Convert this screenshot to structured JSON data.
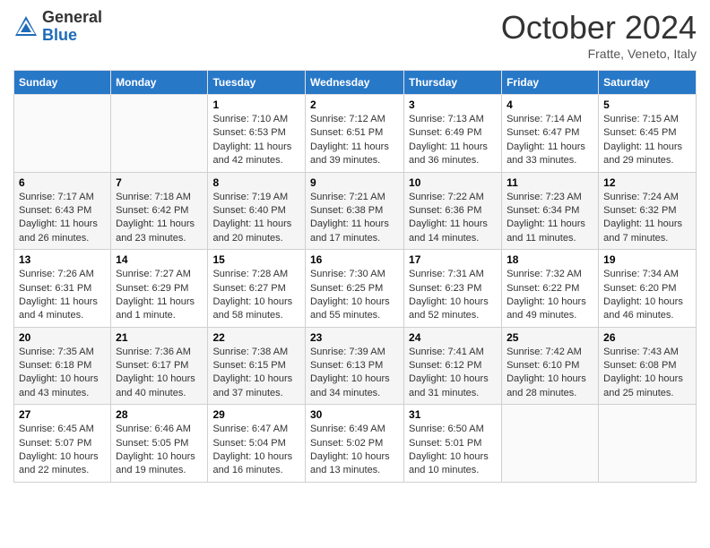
{
  "logo": {
    "general": "General",
    "blue": "Blue"
  },
  "header": {
    "title": "October 2024",
    "subtitle": "Fratte, Veneto, Italy"
  },
  "days_of_week": [
    "Sunday",
    "Monday",
    "Tuesday",
    "Wednesday",
    "Thursday",
    "Friday",
    "Saturday"
  ],
  "weeks": [
    [
      {
        "day": "",
        "content": ""
      },
      {
        "day": "",
        "content": ""
      },
      {
        "day": "1",
        "content": "Sunrise: 7:10 AM\nSunset: 6:53 PM\nDaylight: 11 hours and 42 minutes."
      },
      {
        "day": "2",
        "content": "Sunrise: 7:12 AM\nSunset: 6:51 PM\nDaylight: 11 hours and 39 minutes."
      },
      {
        "day": "3",
        "content": "Sunrise: 7:13 AM\nSunset: 6:49 PM\nDaylight: 11 hours and 36 minutes."
      },
      {
        "day": "4",
        "content": "Sunrise: 7:14 AM\nSunset: 6:47 PM\nDaylight: 11 hours and 33 minutes."
      },
      {
        "day": "5",
        "content": "Sunrise: 7:15 AM\nSunset: 6:45 PM\nDaylight: 11 hours and 29 minutes."
      }
    ],
    [
      {
        "day": "6",
        "content": "Sunrise: 7:17 AM\nSunset: 6:43 PM\nDaylight: 11 hours and 26 minutes."
      },
      {
        "day": "7",
        "content": "Sunrise: 7:18 AM\nSunset: 6:42 PM\nDaylight: 11 hours and 23 minutes."
      },
      {
        "day": "8",
        "content": "Sunrise: 7:19 AM\nSunset: 6:40 PM\nDaylight: 11 hours and 20 minutes."
      },
      {
        "day": "9",
        "content": "Sunrise: 7:21 AM\nSunset: 6:38 PM\nDaylight: 11 hours and 17 minutes."
      },
      {
        "day": "10",
        "content": "Sunrise: 7:22 AM\nSunset: 6:36 PM\nDaylight: 11 hours and 14 minutes."
      },
      {
        "day": "11",
        "content": "Sunrise: 7:23 AM\nSunset: 6:34 PM\nDaylight: 11 hours and 11 minutes."
      },
      {
        "day": "12",
        "content": "Sunrise: 7:24 AM\nSunset: 6:32 PM\nDaylight: 11 hours and 7 minutes."
      }
    ],
    [
      {
        "day": "13",
        "content": "Sunrise: 7:26 AM\nSunset: 6:31 PM\nDaylight: 11 hours and 4 minutes."
      },
      {
        "day": "14",
        "content": "Sunrise: 7:27 AM\nSunset: 6:29 PM\nDaylight: 11 hours and 1 minute."
      },
      {
        "day": "15",
        "content": "Sunrise: 7:28 AM\nSunset: 6:27 PM\nDaylight: 10 hours and 58 minutes."
      },
      {
        "day": "16",
        "content": "Sunrise: 7:30 AM\nSunset: 6:25 PM\nDaylight: 10 hours and 55 minutes."
      },
      {
        "day": "17",
        "content": "Sunrise: 7:31 AM\nSunset: 6:23 PM\nDaylight: 10 hours and 52 minutes."
      },
      {
        "day": "18",
        "content": "Sunrise: 7:32 AM\nSunset: 6:22 PM\nDaylight: 10 hours and 49 minutes."
      },
      {
        "day": "19",
        "content": "Sunrise: 7:34 AM\nSunset: 6:20 PM\nDaylight: 10 hours and 46 minutes."
      }
    ],
    [
      {
        "day": "20",
        "content": "Sunrise: 7:35 AM\nSunset: 6:18 PM\nDaylight: 10 hours and 43 minutes."
      },
      {
        "day": "21",
        "content": "Sunrise: 7:36 AM\nSunset: 6:17 PM\nDaylight: 10 hours and 40 minutes."
      },
      {
        "day": "22",
        "content": "Sunrise: 7:38 AM\nSunset: 6:15 PM\nDaylight: 10 hours and 37 minutes."
      },
      {
        "day": "23",
        "content": "Sunrise: 7:39 AM\nSunset: 6:13 PM\nDaylight: 10 hours and 34 minutes."
      },
      {
        "day": "24",
        "content": "Sunrise: 7:41 AM\nSunset: 6:12 PM\nDaylight: 10 hours and 31 minutes."
      },
      {
        "day": "25",
        "content": "Sunrise: 7:42 AM\nSunset: 6:10 PM\nDaylight: 10 hours and 28 minutes."
      },
      {
        "day": "26",
        "content": "Sunrise: 7:43 AM\nSunset: 6:08 PM\nDaylight: 10 hours and 25 minutes."
      }
    ],
    [
      {
        "day": "27",
        "content": "Sunrise: 6:45 AM\nSunset: 5:07 PM\nDaylight: 10 hours and 22 minutes."
      },
      {
        "day": "28",
        "content": "Sunrise: 6:46 AM\nSunset: 5:05 PM\nDaylight: 10 hours and 19 minutes."
      },
      {
        "day": "29",
        "content": "Sunrise: 6:47 AM\nSunset: 5:04 PM\nDaylight: 10 hours and 16 minutes."
      },
      {
        "day": "30",
        "content": "Sunrise: 6:49 AM\nSunset: 5:02 PM\nDaylight: 10 hours and 13 minutes."
      },
      {
        "day": "31",
        "content": "Sunrise: 6:50 AM\nSunset: 5:01 PM\nDaylight: 10 hours and 10 minutes."
      },
      {
        "day": "",
        "content": ""
      },
      {
        "day": "",
        "content": ""
      }
    ]
  ]
}
